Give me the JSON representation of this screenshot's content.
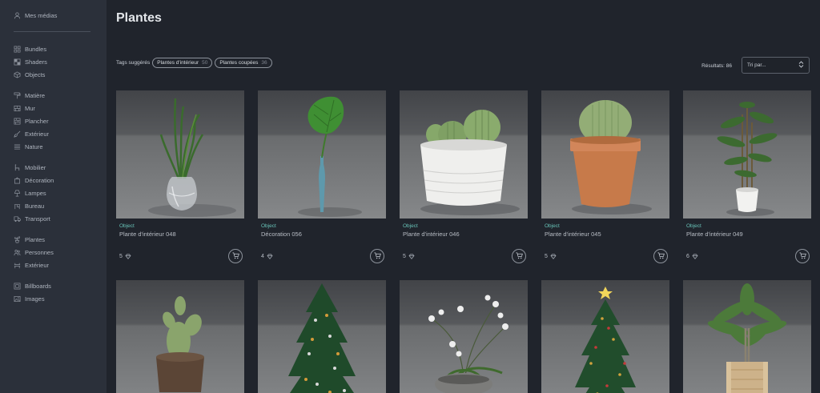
{
  "sidebar": {
    "account": {
      "label": "Mes médias",
      "icon": "user-icon"
    },
    "group1": [
      {
        "label": "Bundles",
        "icon": "grid-icon"
      },
      {
        "label": "Shaders",
        "icon": "checker-icon"
      },
      {
        "label": "Objects",
        "icon": "cube-icon"
      }
    ],
    "group2": [
      {
        "label": "Matière",
        "icon": "paint-roller-icon"
      },
      {
        "label": "Mur",
        "icon": "brick-icon"
      },
      {
        "label": "Plancher",
        "icon": "floor-icon"
      },
      {
        "label": "Extérieur",
        "icon": "brush-icon"
      },
      {
        "label": "Nature",
        "icon": "lines-icon"
      }
    ],
    "group3": [
      {
        "label": "Mobilier",
        "icon": "chair-icon"
      },
      {
        "label": "Décoration",
        "icon": "frame-icon"
      },
      {
        "label": "Lampes",
        "icon": "lamp-icon"
      },
      {
        "label": "Bureau",
        "icon": "desk-icon"
      },
      {
        "label": "Transport",
        "icon": "truck-icon"
      }
    ],
    "group4": [
      {
        "label": "Plantes",
        "icon": "plant-icon"
      },
      {
        "label": "Personnes",
        "icon": "people-icon"
      },
      {
        "label": "Extérieur",
        "icon": "bench-icon"
      }
    ],
    "group5": [
      {
        "label": "Billboards",
        "icon": "billboard-icon"
      },
      {
        "label": "Images",
        "icon": "image-icon"
      }
    ]
  },
  "main": {
    "title": "Plantes",
    "tags_label": "Tags suggérés",
    "tags": [
      {
        "label": "Plantes d'intérieur",
        "count": "50"
      },
      {
        "label": "Plantes coupées",
        "count": "36"
      }
    ],
    "results": "Résultats: 86",
    "sort_placeholder": "Tri par...",
    "cards": [
      {
        "type": "Object",
        "name": "Plante d'intérieur 048",
        "likes": "5",
        "image": "grass-vase"
      },
      {
        "type": "Object",
        "name": "Décoration 056",
        "likes": "4",
        "image": "monstera-bottle"
      },
      {
        "type": "Object",
        "name": "Plante d'intérieur 046",
        "likes": "5",
        "image": "cactus-white-pot"
      },
      {
        "type": "Object",
        "name": "Plante d'intérieur 045",
        "likes": "5",
        "image": "cactus-terracotta"
      },
      {
        "type": "Object",
        "name": "Plante d'intérieur 049",
        "likes": "6",
        "image": "bamboo-pot"
      },
      {
        "type": "",
        "name": "",
        "likes": "",
        "image": "prickly-pear"
      },
      {
        "type": "",
        "name": "",
        "likes": "",
        "image": "christmas-tree"
      },
      {
        "type": "",
        "name": "",
        "likes": "",
        "image": "orchid"
      },
      {
        "type": "",
        "name": "",
        "likes": "",
        "image": "christmas-tree-star"
      },
      {
        "type": "",
        "name": "",
        "likes": "",
        "image": "palm-crate"
      }
    ]
  }
}
